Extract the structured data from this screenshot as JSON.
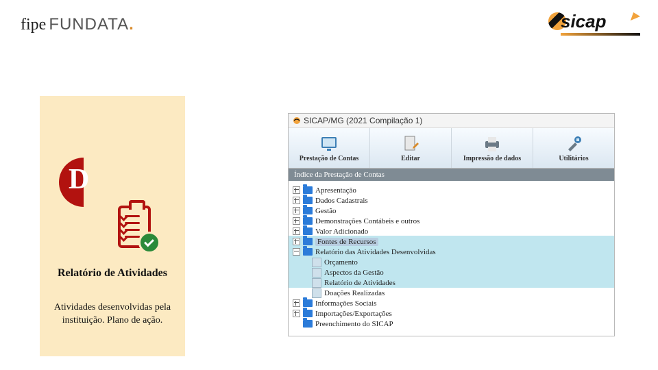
{
  "brand": {
    "part1": "fipe",
    "part2": "FUNDATA",
    "dot": "."
  },
  "logo_text": "sicap",
  "card": {
    "letter": "D",
    "title": "Relatório de Atividades",
    "body": "Atividades desenvolvidas pela instituição. Plano de ação."
  },
  "app": {
    "title": "SICAP/MG (2021 Compilação 1)",
    "toolbar": [
      "Prestação de Contas",
      "Editar",
      "Impressão de dados",
      "Utilitários"
    ],
    "subbar": "Índice da Prestação de Contas",
    "tree": {
      "top": [
        "Apresentação",
        "Dados Cadastrais",
        "Gestão",
        "Demonstrações Contábeis e outros",
        "Valor Adicionado"
      ],
      "selected": "Fontes de Recursos",
      "mid_closed": "Relatório das Atividades Desenvolvidas",
      "children": [
        "Orçamento",
        "Aspectos da Gestão",
        "Relatório de Atividades",
        "Doações Realizadas"
      ],
      "bottom": [
        "Informações Sociais",
        "Importações/Exportações",
        "Preenchimento do SICAP"
      ]
    }
  }
}
